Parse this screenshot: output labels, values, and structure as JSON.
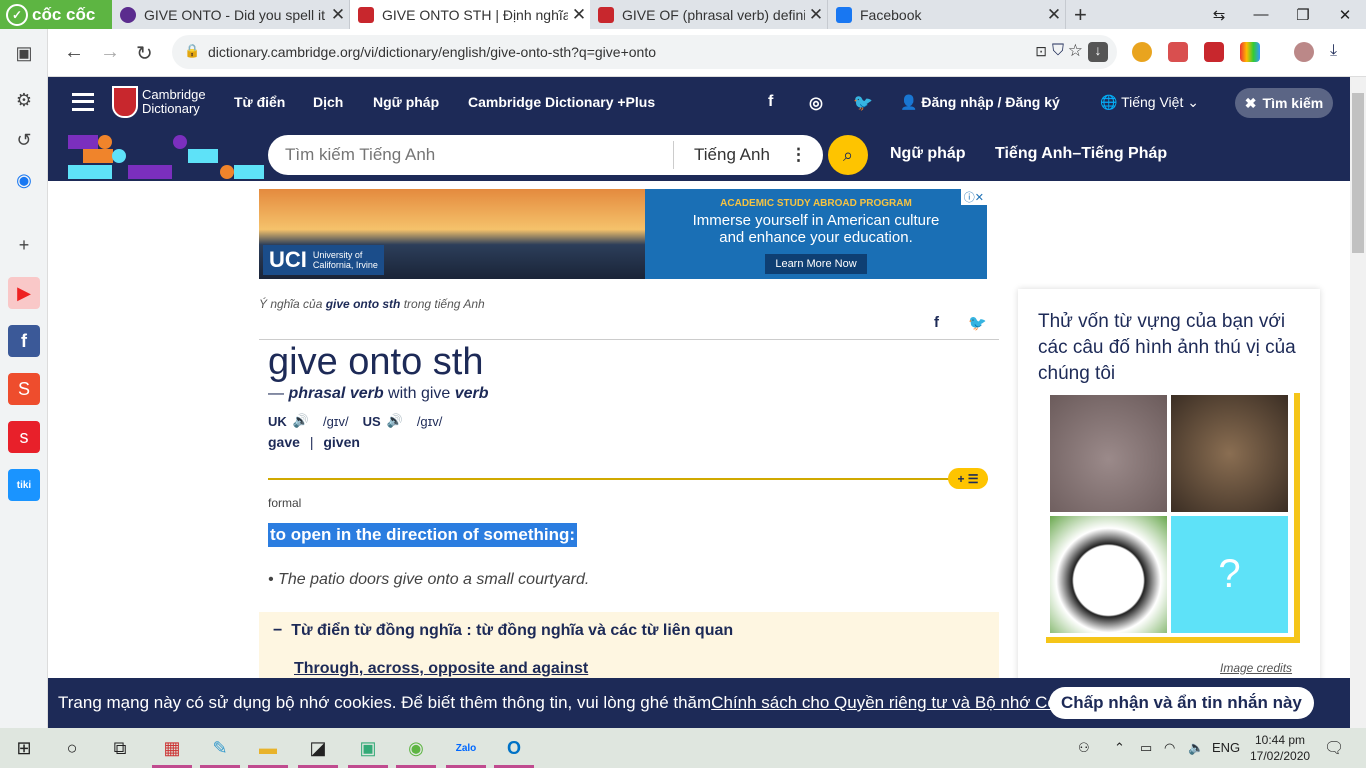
{
  "browser": {
    "brand": "cốc cốc",
    "tabs": [
      {
        "title": "GIVE ONTO - Did you spell it",
        "fav_color": "#5b2c8e"
      },
      {
        "title": "GIVE ONTO STH | Định nghĩa",
        "fav_color": "#c8272d"
      },
      {
        "title": "GIVE OF (phrasal verb) definit",
        "fav_color": "#c8272d"
      },
      {
        "title": "Facebook",
        "fav_color": "#1877f2"
      }
    ],
    "url": "dictionary.cambridge.org/vi/dictionary/english/give-onto-sth?q=give+onto"
  },
  "site": {
    "brand_line1": "Cambridge",
    "brand_line2": "Dictionary",
    "nav": [
      "Từ điển",
      "Dịch",
      "Ngữ pháp",
      "Cambridge Dictionary +Plus"
    ],
    "login": "Đăng nhập / Đăng ký",
    "language": "Tiếng Việt",
    "search_button": "Tìm kiếm",
    "search_placeholder": "Tìm kiếm Tiếng Anh",
    "search_lang": "Tiếng Anh",
    "strip_links": [
      "Ngữ pháp",
      "Tiếng Anh–Tiếng Pháp"
    ]
  },
  "ad": {
    "brand": "UCI",
    "brand_sub1": "University of",
    "brand_sub2": "California, Irvine",
    "kicker": "ACADEMIC STUDY ABROAD PROGRAM",
    "line1": "Immerse yourself in American culture",
    "line2": "and enhance your education.",
    "button": "Learn More Now"
  },
  "entry": {
    "crumb_pre": "Ý nghĩa của ",
    "crumb_word": "give onto sth",
    "crumb_post": " trong tiếng Anh",
    "headword": "give onto sth",
    "pos_dash": "— ",
    "pos": "phrasal verb",
    "pos_with": " with give ",
    "pos_verb": "verb",
    "uk": "UK",
    "uk_ipa": "/ɡɪv/",
    "us": "US",
    "us_ipa": "/ɡɪv/",
    "form1": "gave",
    "form_sep": "|",
    "form2": "given",
    "register": "formal",
    "definition": "to open in the direction of something:",
    "example": "The patio doors give onto a small courtyard.",
    "thesaurus_title": "Từ điển từ đồng nghĩa : từ đồng nghĩa và các từ liên quan",
    "thesaurus_link": "Through, across, opposite and against"
  },
  "quiz": {
    "title": "Thử vốn từ vựng của bạn với các câu đố hình ảnh thú vị của chúng tôi",
    "credits": "Image credits"
  },
  "cookie": {
    "text": "Trang mạng này có sử dụng bộ nhớ cookies. Để biết thêm thông tin, vui lòng ghé thăm ",
    "link": "Chính sách cho Quyền riêng tư và Bộ nhớ Cookies",
    "period": ".",
    "button": "Chấp nhận và ẩn tin nhắn này"
  },
  "taskbar": {
    "lang": "ENG",
    "time": "10:44 pm",
    "date": "17/02/2020"
  }
}
